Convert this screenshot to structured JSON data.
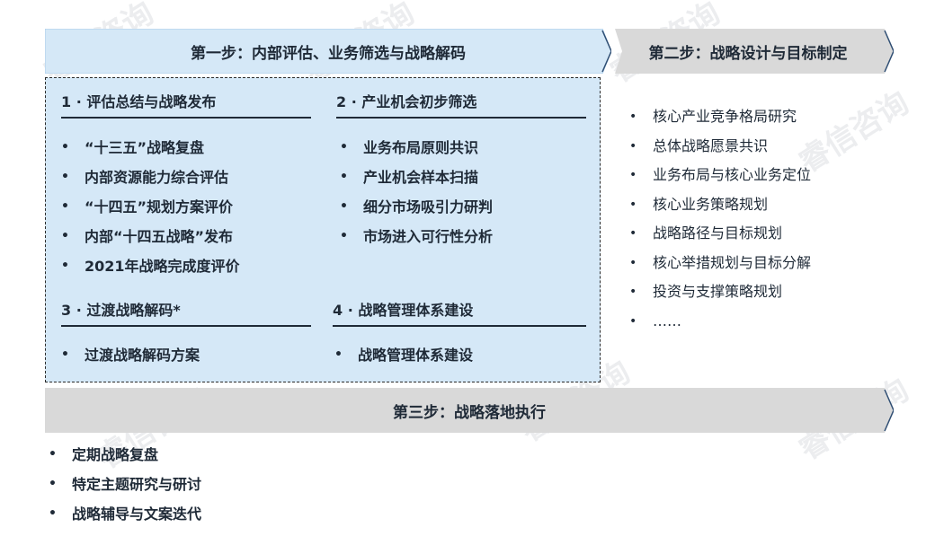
{
  "step1": {
    "title": "第一步：内部评估、业务筛选与战略解码",
    "sections": [
      {
        "title": "1 · 评估总结与战略发布",
        "items": [
          "“十三五”战略复盘",
          "内部资源能力综合评估",
          "“十四五”规划方案评价",
          "内部“十四五战略”发布",
          "2021年战略完成度评价"
        ]
      },
      {
        "title": "2 · 产业机会初步筛选",
        "items": [
          "业务布局原则共识",
          "产业机会样本扫描",
          "细分市场吸引力研判",
          "市场进入可行性分析"
        ]
      },
      {
        "title": "3 · 过渡战略解码*",
        "items": [
          "过渡战略解码方案"
        ]
      },
      {
        "title": "4 · 战略管理体系建设",
        "items": [
          "战略管理体系建设"
        ]
      }
    ]
  },
  "step2": {
    "title": "第二步：战略设计与目标制定",
    "items": [
      "核心产业竞争格局研究",
      "总体战略愿景共识",
      "业务布局与核心业务定位",
      "核心业务策略规划",
      "战略路径与目标规划",
      "核心举措规划与目标分解",
      "投资与支撑策略规划",
      "……"
    ]
  },
  "step3": {
    "title": "第三步：战略落地执行",
    "items": [
      "定期战略复盘",
      "特定主题研究与研讨",
      "战略辅导与文案迭代"
    ]
  },
  "bullet": "•",
  "watermark": "睿信咨询",
  "colors": {
    "step1_fill": "#d5e8f7",
    "step1_stroke": "#a9cbea",
    "grey_fill": "#d9d9d9",
    "chevron": "#2f4e73",
    "text": "#1f2a37"
  }
}
